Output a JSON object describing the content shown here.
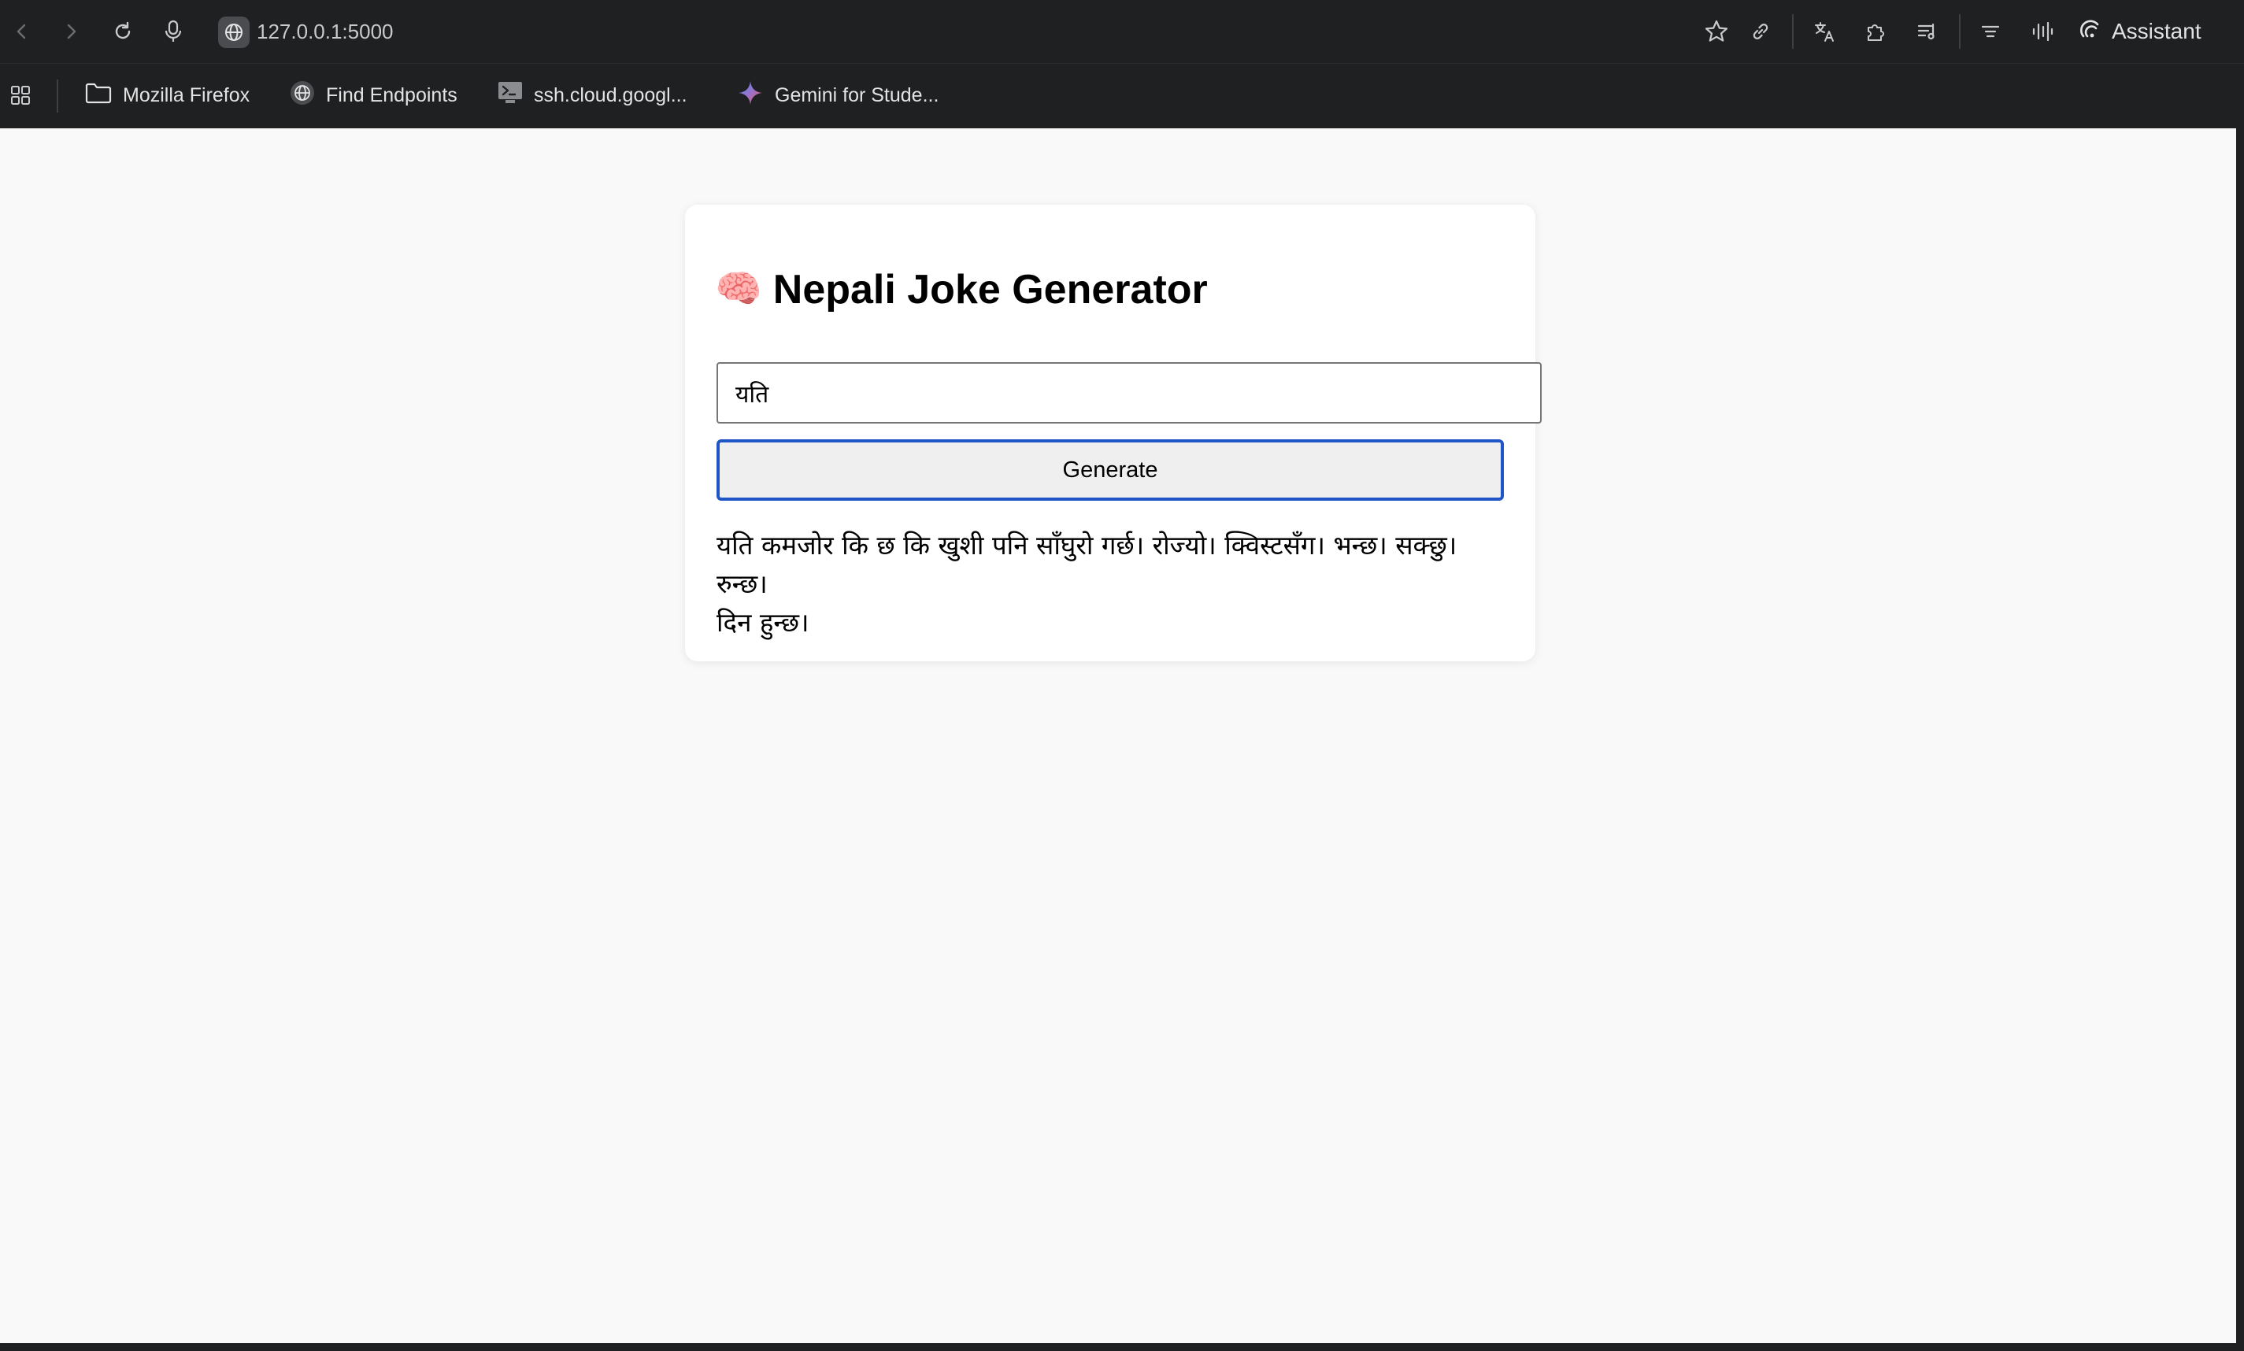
{
  "browser": {
    "url": "127.0.0.1:5000",
    "assistant_label": "Assistant",
    "bookmarks": [
      {
        "label": "Mozilla Firefox",
        "icon": "folder-icon"
      },
      {
        "label": "Find Endpoints",
        "icon": "globe-icon"
      },
      {
        "label": "ssh.cloud.googl...",
        "icon": "terminal-icon"
      },
      {
        "label": "Gemini for Stude...",
        "icon": "gemini-sparkle-icon"
      }
    ],
    "accent_color": "#1f55c7"
  },
  "page": {
    "title_emoji": "🧠",
    "title": "Nepali Joke Generator",
    "input_value": "यति",
    "generate_label": "Generate",
    "joke_line1": "यति कमजोर कि छ कि खुशी पनि साँघुरो गर्छ। रोज्यो। क्विस्टसँग। भन्छ। सक्छु। रुन्छ।",
    "joke_line2": "दिन हुन्छ।"
  }
}
